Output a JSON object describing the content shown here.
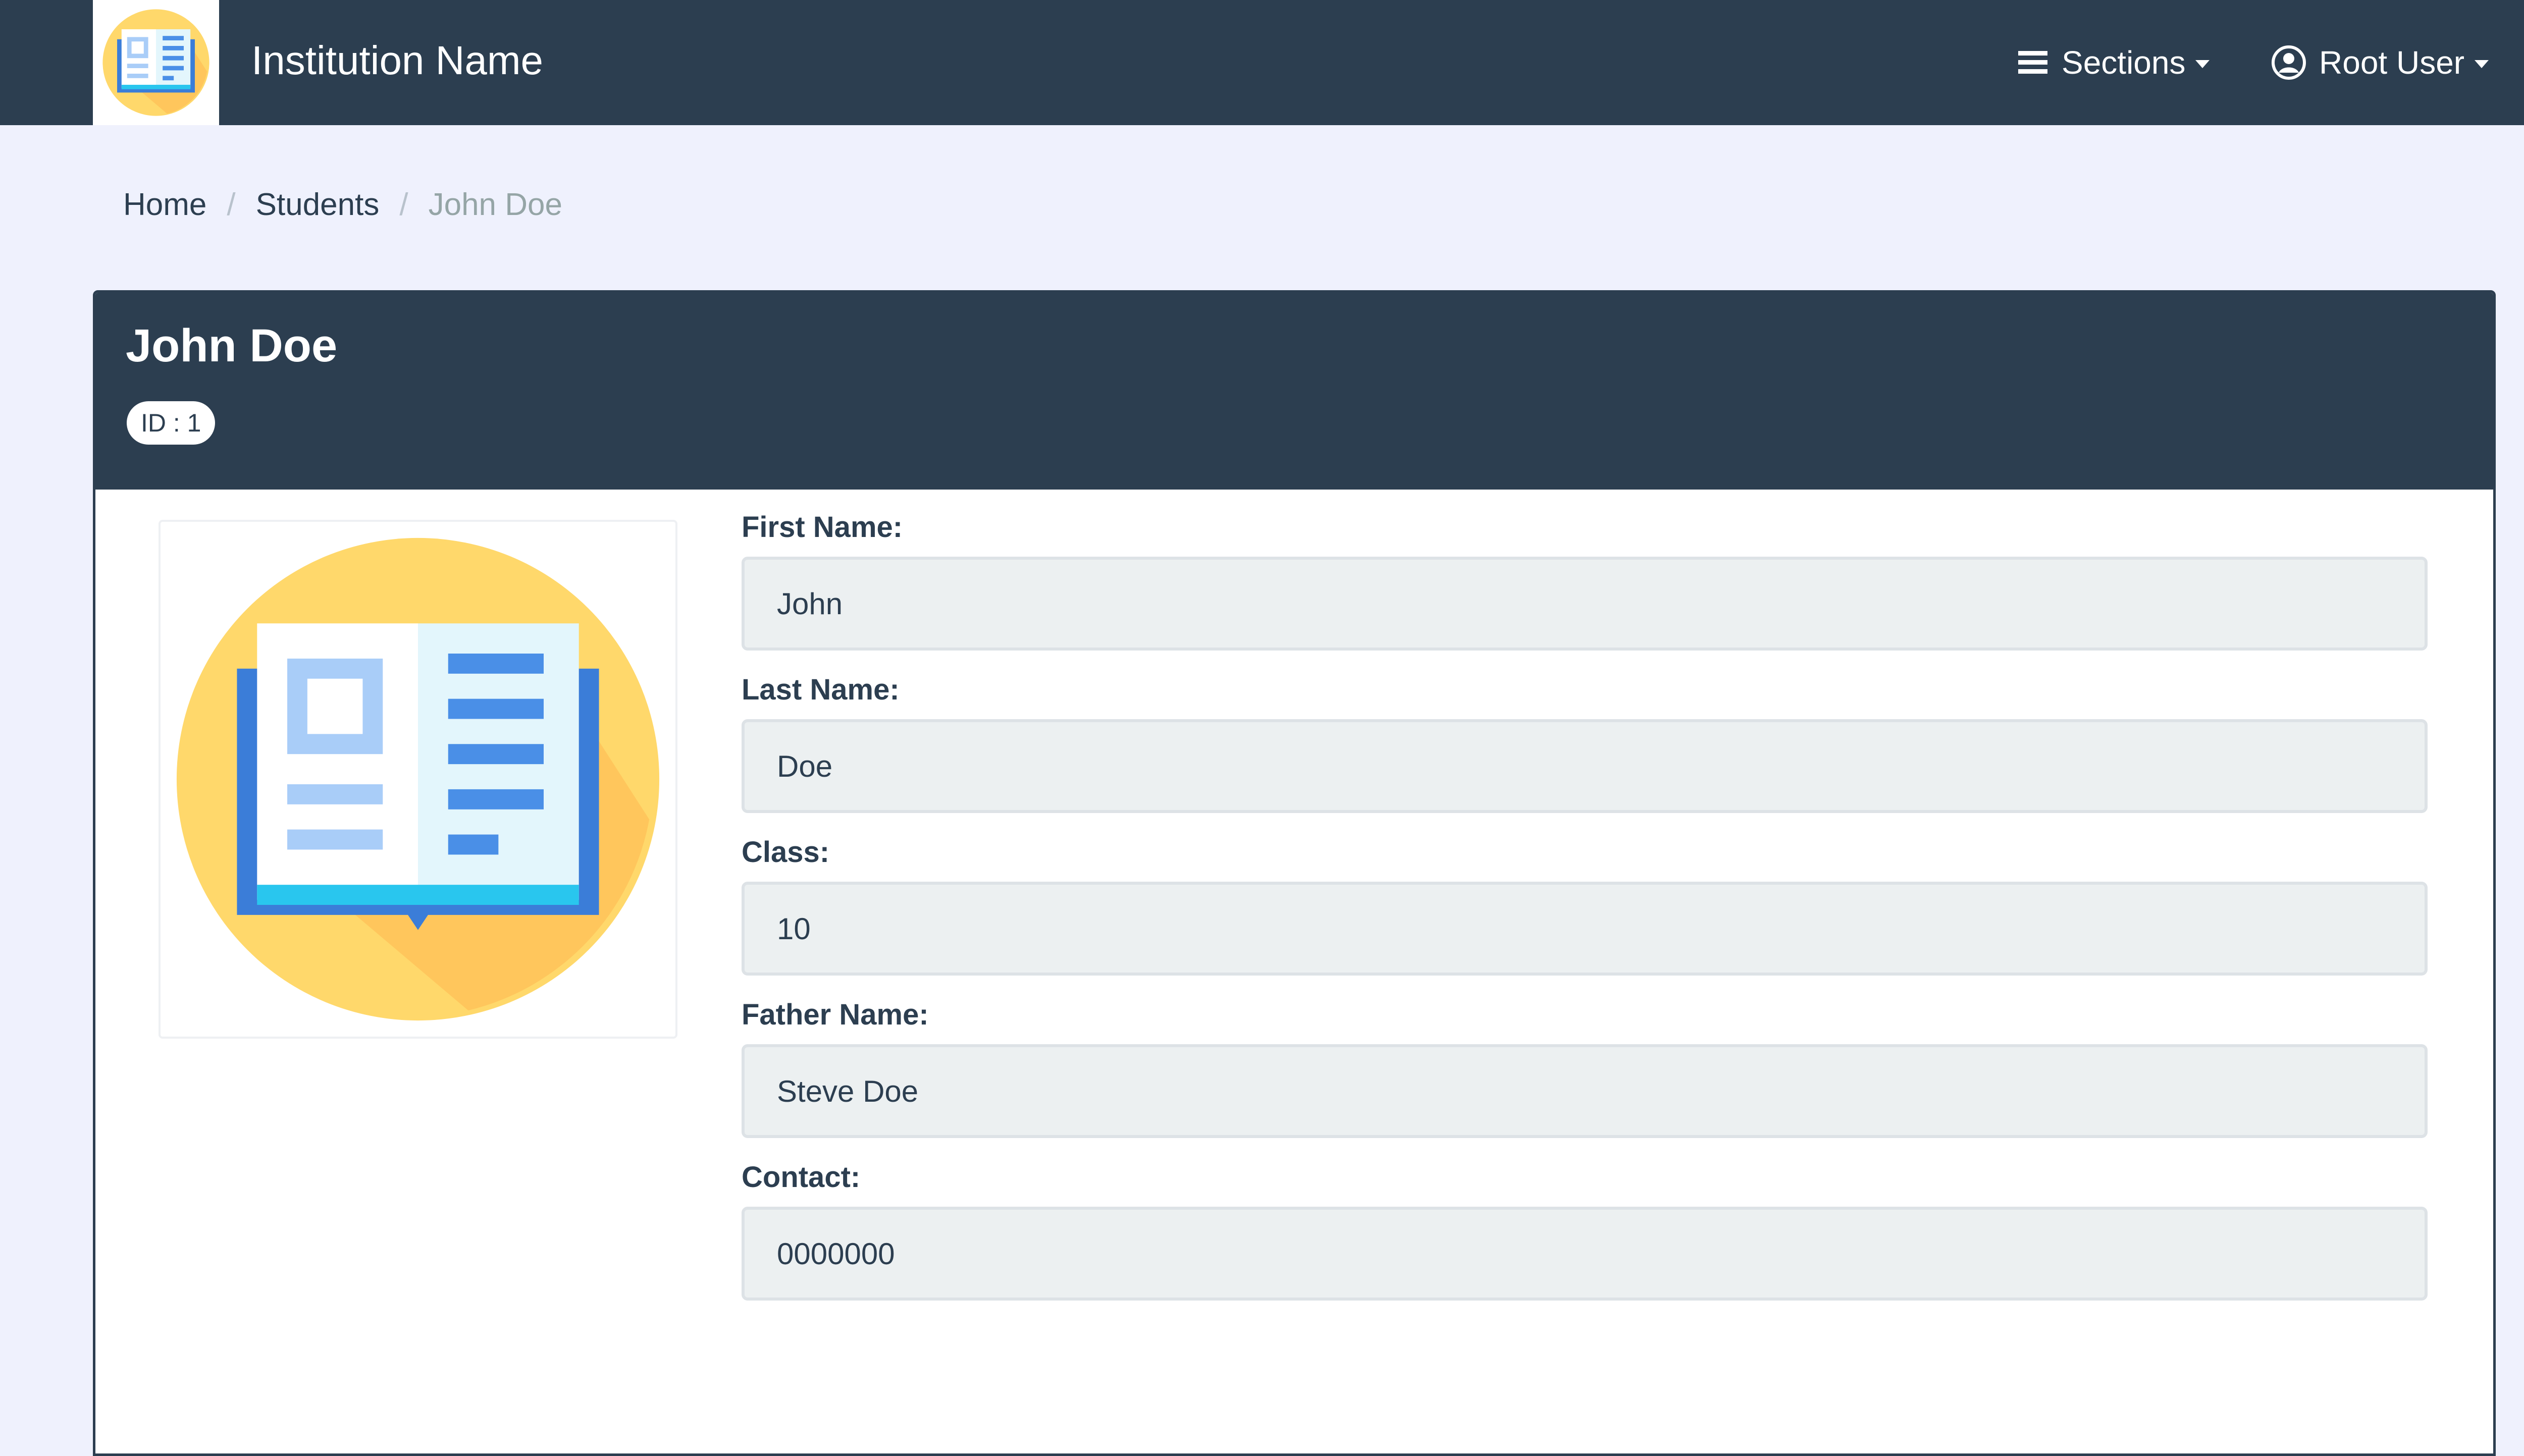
{
  "navbar": {
    "brand_name": "Institution Name",
    "logo_icon": "open-book-icon",
    "sections_label": "Sections",
    "user_label": "Root User"
  },
  "breadcrumb": {
    "items": [
      "Home",
      "Students"
    ],
    "active": "John Doe",
    "separator": "/"
  },
  "student": {
    "name": "John Doe",
    "id_badge": "ID : 1"
  },
  "fields": [
    {
      "label": "First Name:",
      "value": "John"
    },
    {
      "label": "Last Name:",
      "value": "Doe"
    },
    {
      "label": "Class:",
      "value": "10"
    },
    {
      "label": "Father Name:",
      "value": "Steve Doe"
    },
    {
      "label": "Contact:",
      "value": "0000000"
    }
  ],
  "colors": {
    "primary": "#2c3e50",
    "page_bg": "#eff1fd",
    "input_bg": "#ecf0f1",
    "logo_circle": "#ffd86b",
    "book_blue": "#3b7dd8"
  }
}
